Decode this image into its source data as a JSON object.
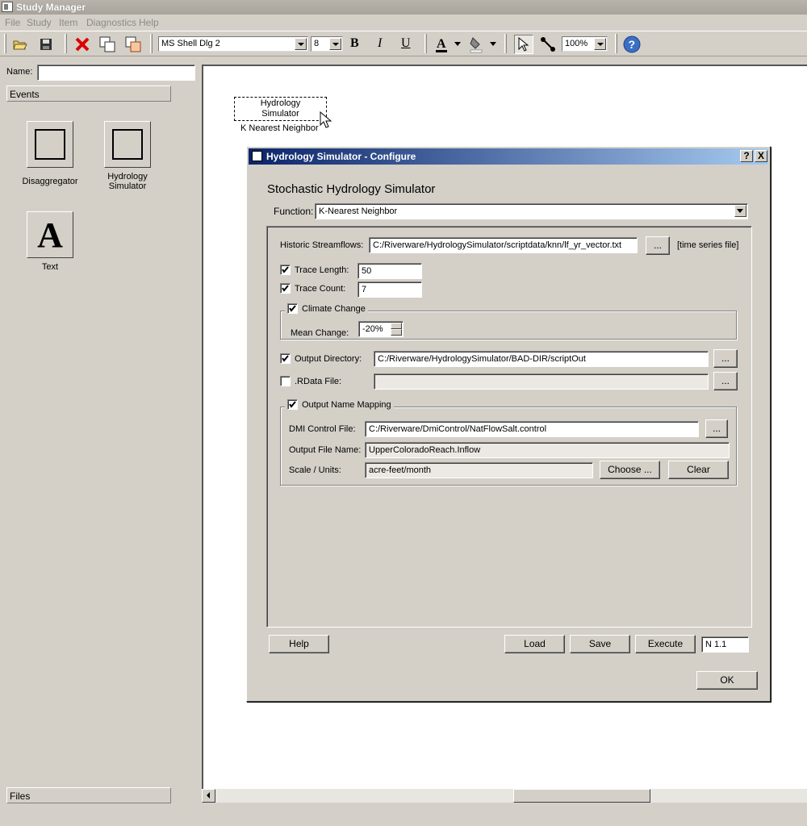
{
  "window": {
    "title": "Study Manager"
  },
  "menu": [
    "File",
    "Study",
    "Item",
    "Diagnostics",
    "Help"
  ],
  "toolbar": {
    "font": "MS Shell Dlg 2",
    "size": "8",
    "bold": "B",
    "italic": "I",
    "underline": "U",
    "zoom": "100%"
  },
  "left_panel": {
    "name_label": "Name:",
    "name_value": "",
    "events_label": "Events",
    "items": [
      "Disaggregator",
      "Hydrology Simulator",
      "Text"
    ],
    "text_glyph": "A",
    "files_label": "Files"
  },
  "canvas": {
    "node_label": "Hydrology Simulator",
    "node_sublabel": "K Nearest Neighbor"
  },
  "dialog": {
    "title": "Hydrology Simulator - Configure",
    "help_glyph": "?",
    "close_glyph": "X",
    "heading": "Stochastic Hydrology Simulator",
    "function_label": "Function:",
    "function_value": "K-Nearest Neighbor",
    "historic_label": "Historic Streamflows:",
    "historic_value": "C:/Riverware/HydrologySimulator/scriptdata/knn/lf_yr_vector.txt",
    "historic_note": "[time series file]",
    "browse": "...",
    "trace_length_label": "Trace Length:",
    "trace_length_value": "50",
    "trace_count_label": "Trace Count:",
    "trace_count_value": "7",
    "climate_label": "Climate Change",
    "mean_change_label": "Mean Change:",
    "mean_change_value": "-20%",
    "output_dir_label": "Output Directory:",
    "output_dir_value": "C:/Riverware/HydrologySimulator/BAD-DIR/scriptOut",
    "rdata_label": ".RData File:",
    "rdata_value": "",
    "mapping_label": "Output Name Mapping",
    "dmi_label": "DMI Control File:",
    "dmi_value": "C:/Riverware/DmiControl/NatFlowSalt.control",
    "outfile_label": "Output File Name:",
    "outfile_value": "UpperColoradoReach.Inflow",
    "scale_label": "Scale / Units:",
    "scale_value": "acre-feet/month",
    "choose_button": "Choose ...",
    "clear_button": "Clear",
    "help_button": "Help",
    "load_button": "Load",
    "save_button": "Save",
    "execute_button": "Execute",
    "version_value": "N 1.1",
    "ok_button": "OK"
  }
}
